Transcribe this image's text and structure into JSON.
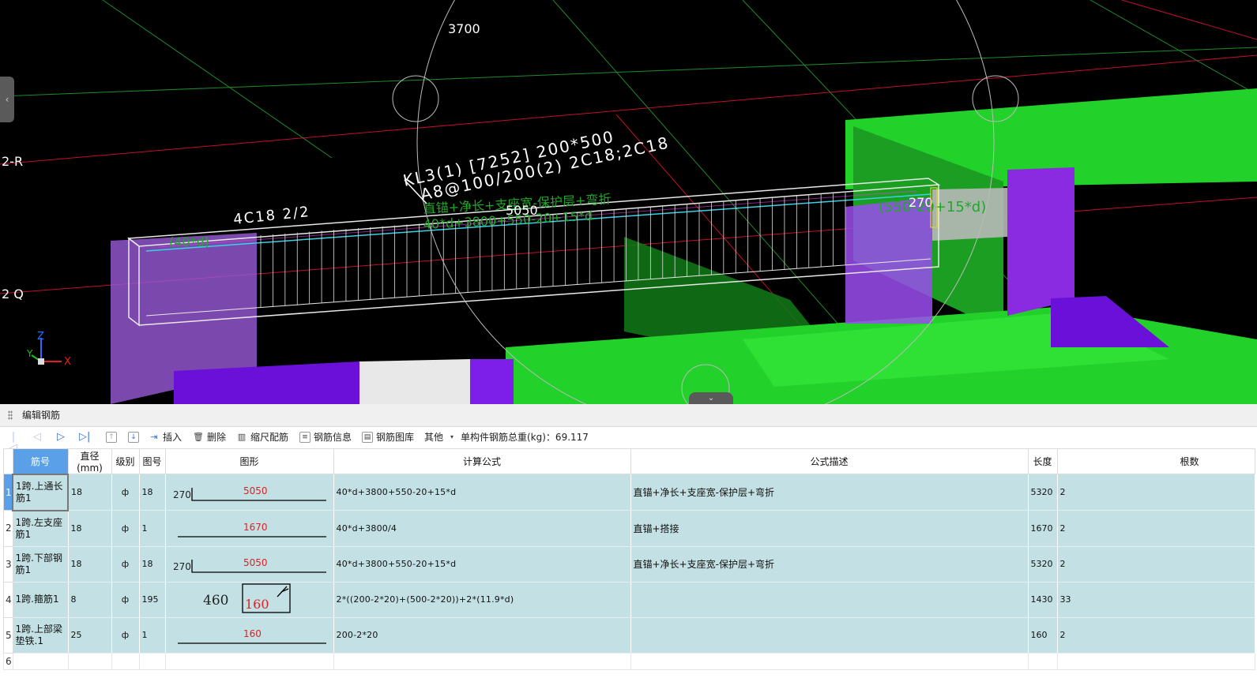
{
  "viewport": {
    "dim_top": "3700",
    "axis_r": "2-R",
    "axis_q": "2 Q",
    "beam_label_line1": "KL3(1) [7252] 200*500",
    "beam_label_line2": "A8@100/200(2) 2C18;2C18",
    "top_bar_label": "4C18 2/2",
    "anchor_green_1": "直锚+净长+支座宽-保护层+弯折",
    "anchor_green_2": "40*d+3800+550-20+15*d",
    "span_len": "5050",
    "left_anchor": "(40*d)",
    "right_anchor": "(550-20+15*d)",
    "right_hook": "270",
    "axis_x": "X",
    "axis_z": "Z",
    "axis_y": "Y",
    "colors": {
      "beam_green": "#22d12a",
      "column_purple": "#8a2be2",
      "grid_red": "#c0102a",
      "grid_green": "#1f8a2a"
    }
  },
  "panel": {
    "title": "编辑钢筋",
    "toolbar": {
      "insert": "插入",
      "delete": "删除",
      "scale": "缩尺配筋",
      "info": "钢筋信息",
      "library": "钢筋图库",
      "other": "其他",
      "total_weight": "单构件钢筋总重(kg)：69.117"
    },
    "columns": [
      "筋号",
      "直径(mm)",
      "级别",
      "图号",
      "图形",
      "计算公式",
      "公式描述",
      "长度",
      "根数"
    ],
    "rows": [
      {
        "no": "1",
        "name": "1跨.上通长筋1",
        "dia": "18",
        "grade": "ф",
        "fig": "18",
        "shape_left": "270",
        "shape_mid": "5050",
        "formula": "40*d+3800+550-20+15*d",
        "desc": "直锚+净长+支座宽-保护层+弯折",
        "length": "5320",
        "count": "2"
      },
      {
        "no": "2",
        "name": "1跨.左支座筋1",
        "dia": "18",
        "grade": "ф",
        "fig": "1",
        "shape_left": "",
        "shape_mid": "1670",
        "formula": "40*d+3800/4",
        "desc": "直锚+搭接",
        "length": "1670",
        "count": "2"
      },
      {
        "no": "3",
        "name": "1跨.下部钢筋1",
        "dia": "18",
        "grade": "ф",
        "fig": "18",
        "shape_left": "270",
        "shape_mid": "5050",
        "formula": "40*d+3800+550-20+15*d",
        "desc": "直锚+净长+支座宽-保护层+弯折",
        "length": "5320",
        "count": "2"
      },
      {
        "no": "4",
        "name": "1跨.箍筋1",
        "dia": "8",
        "grade": "ф",
        "fig": "195",
        "shape_left": "460",
        "shape_mid": "160",
        "formula": "2*((200-2*20)+(500-2*20))+2*(11.9*d)",
        "desc": "",
        "length": "1430",
        "count": "33"
      },
      {
        "no": "5",
        "name": "1跨.上部梁垫铁.1",
        "dia": "25",
        "grade": "ф",
        "fig": "1",
        "shape_left": "",
        "shape_mid": "160",
        "formula": "200-2*20",
        "desc": "",
        "length": "160",
        "count": "2"
      },
      {
        "no": "6",
        "name": "",
        "dia": "",
        "grade": "",
        "fig": "",
        "shape_left": "",
        "shape_mid": "",
        "formula": "",
        "desc": "",
        "length": "",
        "count": ""
      }
    ]
  }
}
